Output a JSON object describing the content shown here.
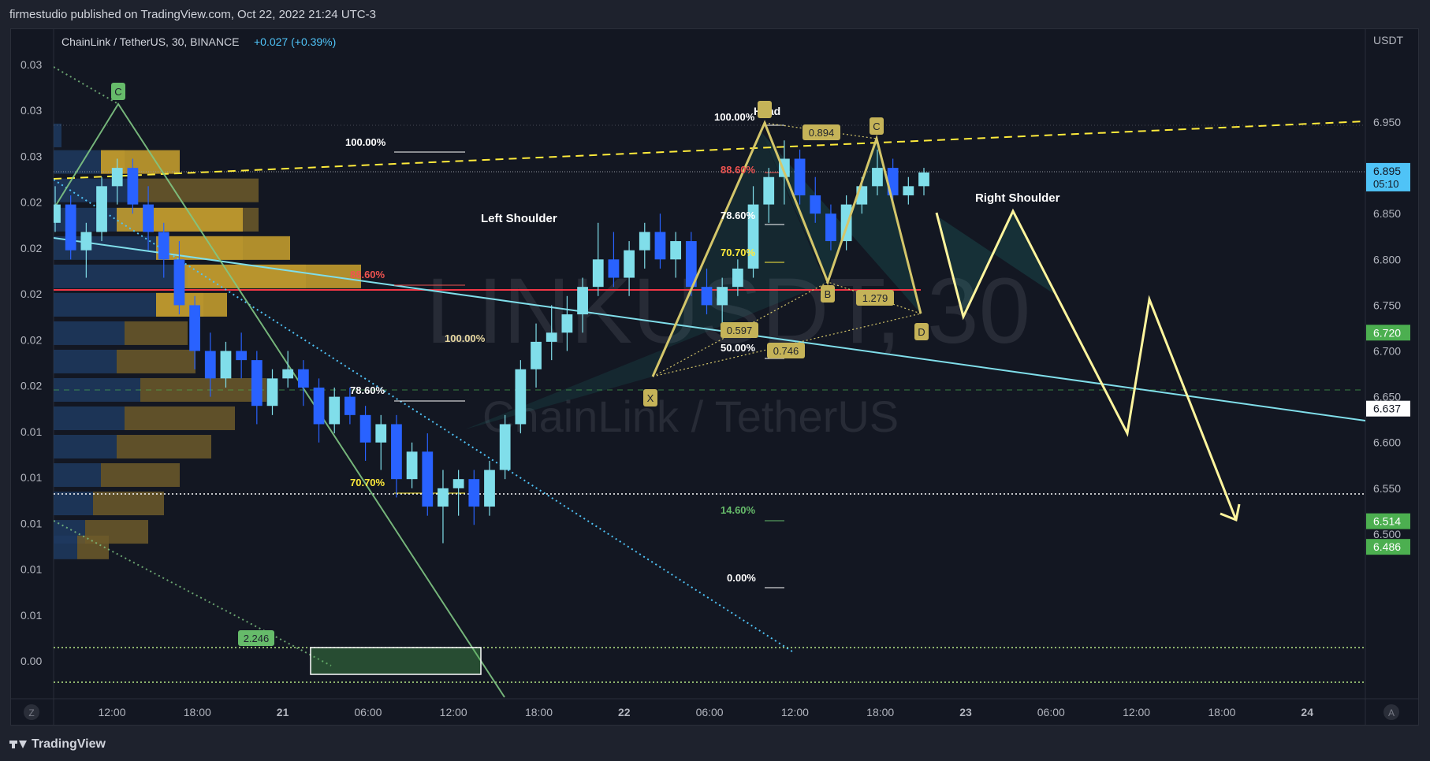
{
  "header": {
    "published": "firmestudio published on TradingView.com, Oct 22, 2022 21:24 UTC-3"
  },
  "footer": {
    "logo": "TradingView"
  },
  "symbol": {
    "name": "ChainLink / TetherUS, 30, BINANCE",
    "change": "+0.027 (+0.39%)",
    "watermark_big": "LINKUSDT, 30",
    "watermark_small": "ChainLink / TetherUS"
  },
  "chart_data": {
    "type": "candlestick",
    "currency": "USDT",
    "ylim": [
      6.46,
      6.975
    ],
    "right_axis_ticks": [
      "6.950",
      "6.900",
      "6.850",
      "6.800",
      "6.750",
      "6.700",
      "6.650",
      "6.600",
      "6.550",
      "6.500"
    ],
    "right_axis_values": [
      6.95,
      6.9,
      6.85,
      6.8,
      6.75,
      6.7,
      6.65,
      6.6,
      6.55,
      6.5
    ],
    "left_axis_ticks": [
      "0.03",
      "0.03",
      "0.03",
      "0.02",
      "0.02",
      "0.02",
      "0.02",
      "0.02",
      "0.01",
      "0.01",
      "0.01",
      "0.01",
      "0.01",
      "0.00"
    ],
    "x_ticks": [
      "12:00",
      "18:00",
      "21",
      "06:00",
      "12:00",
      "18:00",
      "22",
      "06:00",
      "12:00",
      "18:00",
      "23",
      "06:00",
      "12:00",
      "18:00",
      "24"
    ],
    "price_labels": [
      {
        "text": "6.895",
        "sub": "05:10",
        "value": 6.895,
        "color": "#4fc3f7"
      },
      {
        "text": "6.720",
        "value": 6.72,
        "color": "#4caf50"
      },
      {
        "text": "6.637",
        "value": 6.637,
        "color": "#ffffff"
      },
      {
        "text": "6.514",
        "value": 6.514,
        "color": "#4caf50"
      },
      {
        "text": "6.486",
        "value": 6.486,
        "color": "#4caf50"
      }
    ],
    "annotations": {
      "left_shoulder": "Left Shoulder",
      "head": "Head",
      "right_shoulder": "Right Shoulder",
      "fib_left": [
        "100.00%",
        "88.60%",
        "78.60%",
        "70.70%"
      ],
      "fib_right": [
        "100.00%",
        "88.60%",
        "78.60%",
        "70.70%",
        "50.00%",
        "14.60%",
        "0.00%"
      ],
      "fib_mid": "100.00%",
      "harmonic_points": [
        "X",
        "B",
        "C",
        "D"
      ],
      "harmonic_ratios": [
        "0.894",
        "1.279",
        "0.597",
        "0.746"
      ],
      "left_c_label": "C",
      "ratio_2246": "2.246"
    },
    "candles": [
      [
        6.84,
        6.88,
        6.83,
        6.86
      ],
      [
        6.86,
        6.87,
        6.8,
        6.81
      ],
      [
        6.81,
        6.84,
        6.78,
        6.83
      ],
      [
        6.83,
        6.89,
        6.82,
        6.88
      ],
      [
        6.88,
        6.91,
        6.86,
        6.9
      ],
      [
        6.9,
        6.91,
        6.85,
        6.86
      ],
      [
        6.86,
        6.88,
        6.81,
        6.83
      ],
      [
        6.83,
        6.84,
        6.78,
        6.8
      ],
      [
        6.8,
        6.82,
        6.74,
        6.75
      ],
      [
        6.75,
        6.76,
        6.68,
        6.7
      ],
      [
        6.7,
        6.72,
        6.65,
        6.67
      ],
      [
        6.67,
        6.71,
        6.66,
        6.7
      ],
      [
        6.7,
        6.72,
        6.67,
        6.69
      ],
      [
        6.69,
        6.7,
        6.62,
        6.64
      ],
      [
        6.64,
        6.68,
        6.63,
        6.67
      ],
      [
        6.67,
        6.7,
        6.66,
        6.68
      ],
      [
        6.68,
        6.69,
        6.64,
        6.66
      ],
      [
        6.66,
        6.67,
        6.6,
        6.62
      ],
      [
        6.62,
        6.66,
        6.61,
        6.65
      ],
      [
        6.65,
        6.66,
        6.62,
        6.63
      ],
      [
        6.63,
        6.64,
        6.58,
        6.6
      ],
      [
        6.6,
        6.63,
        6.57,
        6.62
      ],
      [
        6.62,
        6.63,
        6.54,
        6.56
      ],
      [
        6.56,
        6.6,
        6.55,
        6.59
      ],
      [
        6.59,
        6.61,
        6.52,
        6.53
      ],
      [
        6.53,
        6.57,
        6.49,
        6.55
      ],
      [
        6.55,
        6.57,
        6.52,
        6.56
      ],
      [
        6.56,
        6.57,
        6.51,
        6.53
      ],
      [
        6.53,
        6.58,
        6.52,
        6.57
      ],
      [
        6.57,
        6.63,
        6.56,
        6.62
      ],
      [
        6.62,
        6.69,
        6.61,
        6.68
      ],
      [
        6.68,
        6.73,
        6.66,
        6.71
      ],
      [
        6.71,
        6.75,
        6.69,
        6.72
      ],
      [
        6.72,
        6.76,
        6.7,
        6.74
      ],
      [
        6.74,
        6.78,
        6.72,
        6.77
      ],
      [
        6.77,
        6.84,
        6.76,
        6.8
      ],
      [
        6.8,
        6.83,
        6.77,
        6.78
      ],
      [
        6.78,
        6.82,
        6.76,
        6.81
      ],
      [
        6.81,
        6.84,
        6.79,
        6.83
      ],
      [
        6.83,
        6.85,
        6.79,
        6.8
      ],
      [
        6.8,
        6.83,
        6.78,
        6.82
      ],
      [
        6.82,
        6.83,
        6.76,
        6.77
      ],
      [
        6.77,
        6.79,
        6.74,
        6.75
      ],
      [
        6.75,
        6.78,
        6.73,
        6.77
      ],
      [
        6.77,
        6.8,
        6.76,
        6.79
      ],
      [
        6.79,
        6.88,
        6.78,
        6.86
      ],
      [
        6.86,
        6.9,
        6.84,
        6.89
      ],
      [
        6.89,
        6.93,
        6.86,
        6.91
      ],
      [
        6.91,
        6.92,
        6.86,
        6.87
      ],
      [
        6.87,
        6.89,
        6.84,
        6.85
      ],
      [
        6.85,
        6.86,
        6.81,
        6.82
      ],
      [
        6.82,
        6.87,
        6.81,
        6.86
      ],
      [
        6.86,
        6.89,
        6.85,
        6.88
      ],
      [
        6.88,
        6.92,
        6.87,
        6.9
      ],
      [
        6.9,
        6.91,
        6.86,
        6.87
      ],
      [
        6.87,
        6.89,
        6.86,
        6.88
      ],
      [
        6.88,
        6.9,
        6.87,
        6.895
      ]
    ]
  }
}
